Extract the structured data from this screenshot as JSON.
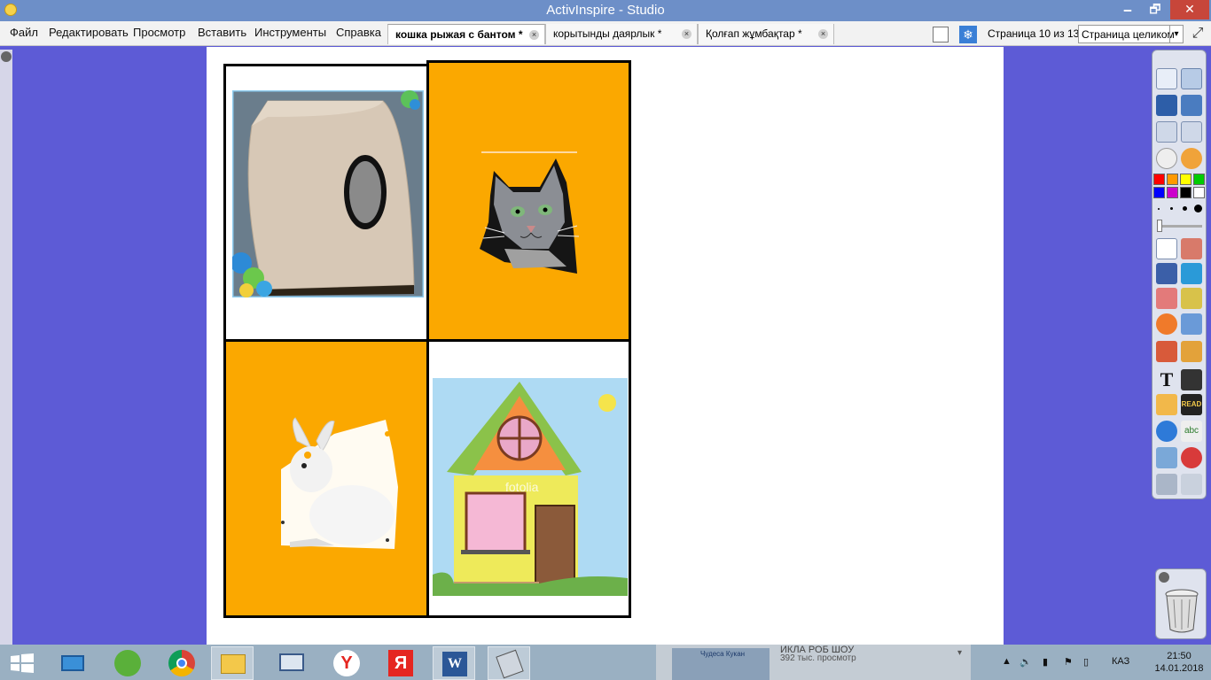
{
  "window": {
    "title": "ActivInspire - Studio",
    "minimize": "🗕",
    "maximize": "🗗",
    "close": "✕"
  },
  "menu": [
    "Файл",
    "Редактировать",
    "Просмотр",
    "Вставить",
    "Инструменты",
    "Справка"
  ],
  "tabs": [
    {
      "label": "кошка рыжая с бантом *",
      "active": true
    },
    {
      "label": "корытынды даярлык *",
      "active": false
    },
    {
      "label": "Қолғап жұмбақтар *",
      "active": false
    }
  ],
  "tab_close_glyph": "×",
  "page_status": "Страница 10 из 13",
  "zoom": {
    "value": "Страница целиком",
    "arrow": "▾"
  },
  "flipchart": {
    "watermark": "fotolia",
    "cells": [
      {
        "picture": "cat-house"
      },
      {
        "picture": "cat-head"
      },
      {
        "picture": "white-rabbit"
      },
      {
        "picture": "cartoon-house"
      }
    ]
  },
  "palette": {
    "colors": [
      "#ff0000",
      "#ff9900",
      "#ffff00",
      "#00cc00",
      "#0000ff",
      "#cc00cc",
      "#000000",
      "#ffffff"
    ],
    "tools": [
      "browser-icon",
      "profile-icon",
      "annotate-icon",
      "designer-icon",
      "previous-page-icon",
      "next-page-icon",
      "play-icon",
      "revealer-icon",
      "select-icon",
      "tools-icon",
      "pen-icon",
      "highlighter-icon",
      "eraser-icon",
      "fill-icon",
      "shape-icon",
      "connector-icon",
      "stamp-icon",
      "clone-icon",
      "text-icon",
      "grid-icon",
      "handwriting-icon",
      "read-icon",
      "web-icon",
      "spellcheck-icon",
      "clear-icon",
      "refresh-icon",
      "undo-icon",
      "redo-icon"
    ],
    "text_tool_glyph": "T",
    "read_label": "READ",
    "spell_label": "abc"
  },
  "taskbar": {
    "apps": [
      "start-icon",
      "desktop-icon",
      "utorrent-icon",
      "chrome-icon",
      "explorer-icon",
      "monitor-icon",
      "yandex-icon",
      "yandex-browser-icon",
      "word-icon",
      "activinspire-icon"
    ],
    "ad_line1": "ИКЛА РОБ ШОУ",
    "ad_line2": "392 тыс. просмотр",
    "ad_badge": "Чудеса Кукан",
    "ad_arrow": "▾",
    "lang": "КАЗ",
    "time": "21:50",
    "date": "14.01.2018"
  }
}
